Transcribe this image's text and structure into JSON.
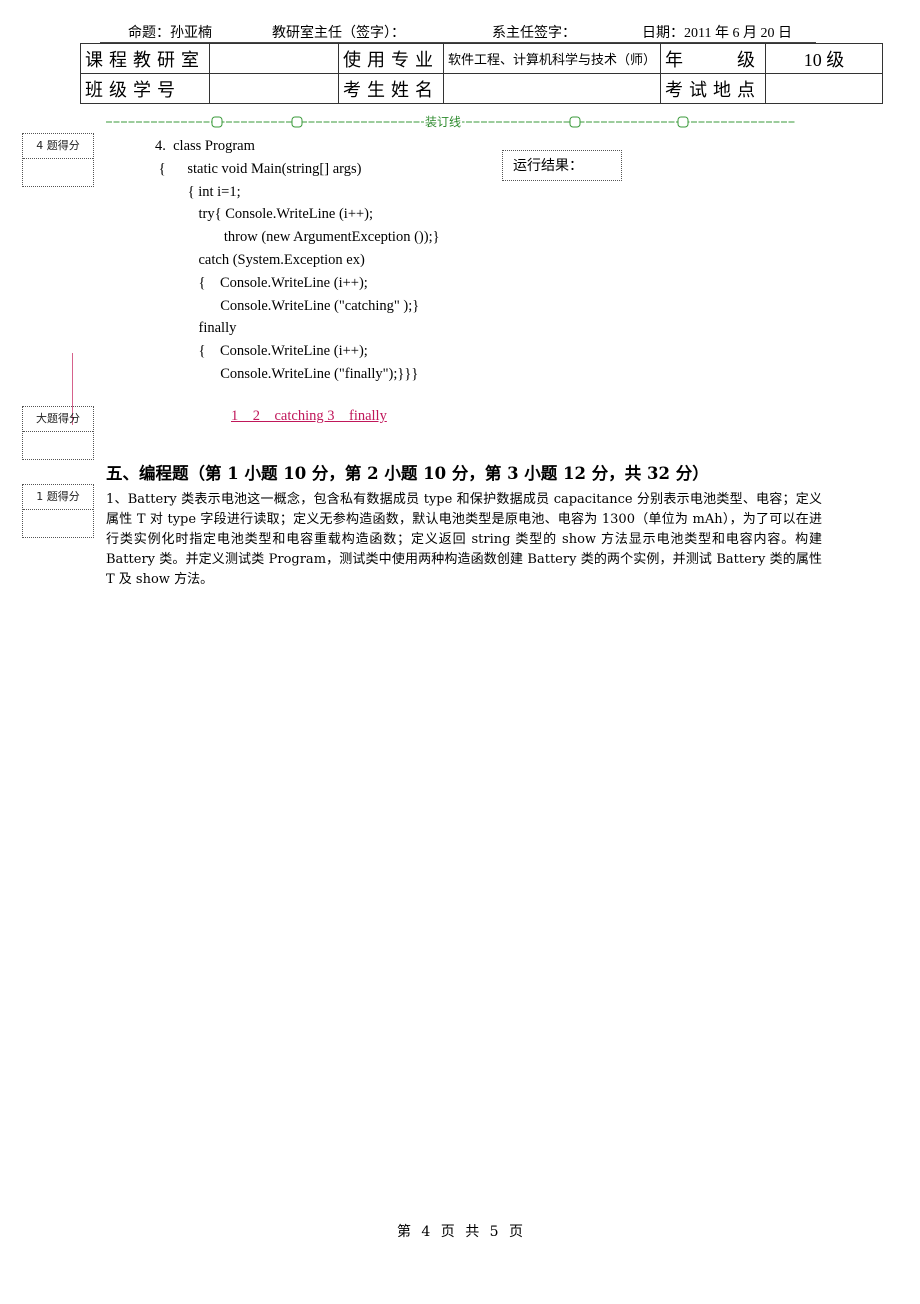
{
  "header": {
    "author": "命题：孙亚楠",
    "director_sign": "教研室主任（签字）：",
    "dept_head_sign": "系主任签字：",
    "date": "日期：2011 年 6 月 20 日"
  },
  "info_table": {
    "row1": {
      "course_dept_label": "课程教研室",
      "course_dept_value": "",
      "major_label": "使用专业",
      "major_value": "软件工程、计算机科学与技术（师）",
      "grade_label_left": "年",
      "grade_label_right": "级",
      "grade_value": "10 级"
    },
    "row2": {
      "class_id_label": "班级学号",
      "class_id_value": "",
      "student_name_label": "考生姓名",
      "student_name_value": "",
      "exam_location_label": "考试地点",
      "exam_location_value": ""
    }
  },
  "binding_line": {
    "label": "装订线",
    "color": "#2e8b2e"
  },
  "score_boxes": {
    "q4": "4 题得分",
    "section": "大题得分",
    "q1": "1 题得分"
  },
  "question4": {
    "code_lines": [
      "4.  class Program",
      " {      static void Main(string[] args)",
      "         { int i=1;",
      "            try{ Console.WriteLine (i++);",
      "                   throw (new ArgumentException ());}",
      "            catch (System.Exception ex)",
      "            {    Console.WriteLine (i++);",
      "                  Console.WriteLine (\"catching\" );}",
      "            finally",
      "            {    Console.WriteLine (i++);",
      "                  Console.WriteLine (\"finally\");}}}"
    ],
    "result_label": "运行结果：",
    "answer": "1    2    catching 3    finally",
    "answer_color": "#c0175a"
  },
  "section5": {
    "title": "五、编程题（第 1 小题 10 分，第 2 小题 10 分，第 3 小题 12 分，共 32 分）",
    "question1": "1、Battery 类表示电池这一概念，包含私有数据成员 type 和保护数据成员 capacitance 分别表示电池类型、电容；定义属性 T 对 type 字段进行读取；定义无参构造函数，默认电池类型是原电池、电容为 1300（单位为 mAh），为了可以在进行类实例化时指定电池类型和电容重载构造函数；定义返回 string 类型的 show 方法显示电池类型和电容内容。构建 Battery 类。并定义测试类 Program，测试类中使用两种构造函数创建 Battery 类的两个实例，并测试 Battery 类的属性 T 及 show 方法。"
  },
  "footer": {
    "page": "第 4 页 共 5 页"
  }
}
